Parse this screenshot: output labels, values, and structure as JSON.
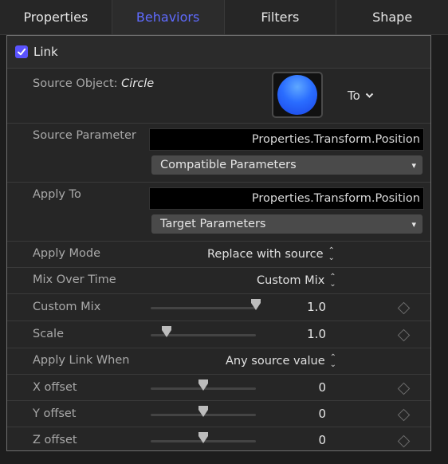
{
  "tabs": [
    {
      "label": "Properties",
      "active": false
    },
    {
      "label": "Behaviors",
      "active": true
    },
    {
      "label": "Filters",
      "active": false
    },
    {
      "label": "Shape",
      "active": false
    }
  ],
  "link": {
    "label": "Link",
    "checked": true
  },
  "source_object": {
    "label": "Source Object:",
    "name": "Circle",
    "swatch_color": "#2a6dff",
    "to_label": "To"
  },
  "source_parameter": {
    "label": "Source Parameter",
    "value": "Properties.Transform.Position",
    "dropdown": "Compatible Parameters"
  },
  "apply_to": {
    "label": "Apply To",
    "value": "Properties.Transform.Position",
    "dropdown": "Target Parameters"
  },
  "apply_mode": {
    "label": "Apply Mode",
    "value": "Replace with source"
  },
  "mix_over_time": {
    "label": "Mix Over Time",
    "value": "Custom Mix"
  },
  "custom_mix": {
    "label": "Custom Mix",
    "value": "1.0",
    "level": 1.0
  },
  "scale": {
    "label": "Scale",
    "value": "1.0",
    "level": 0.15
  },
  "apply_link_when": {
    "label": "Apply Link When",
    "value": "Any source value"
  },
  "x_offset": {
    "label": "X offset",
    "value": "0",
    "level": 0.5
  },
  "y_offset": {
    "label": "Y offset",
    "value": "0",
    "level": 0.5
  },
  "z_offset": {
    "label": "Z offset",
    "value": "0",
    "level": 0.5
  },
  "colors": {
    "accent": "#5a53ff",
    "active_tab": "#5f6bff"
  },
  "icons": {
    "checkbox": "checkmark-icon",
    "to_dropdown": "chevron-down-icon",
    "popup": "updown-chevron-icon",
    "keyframe": "diamond-icon"
  }
}
